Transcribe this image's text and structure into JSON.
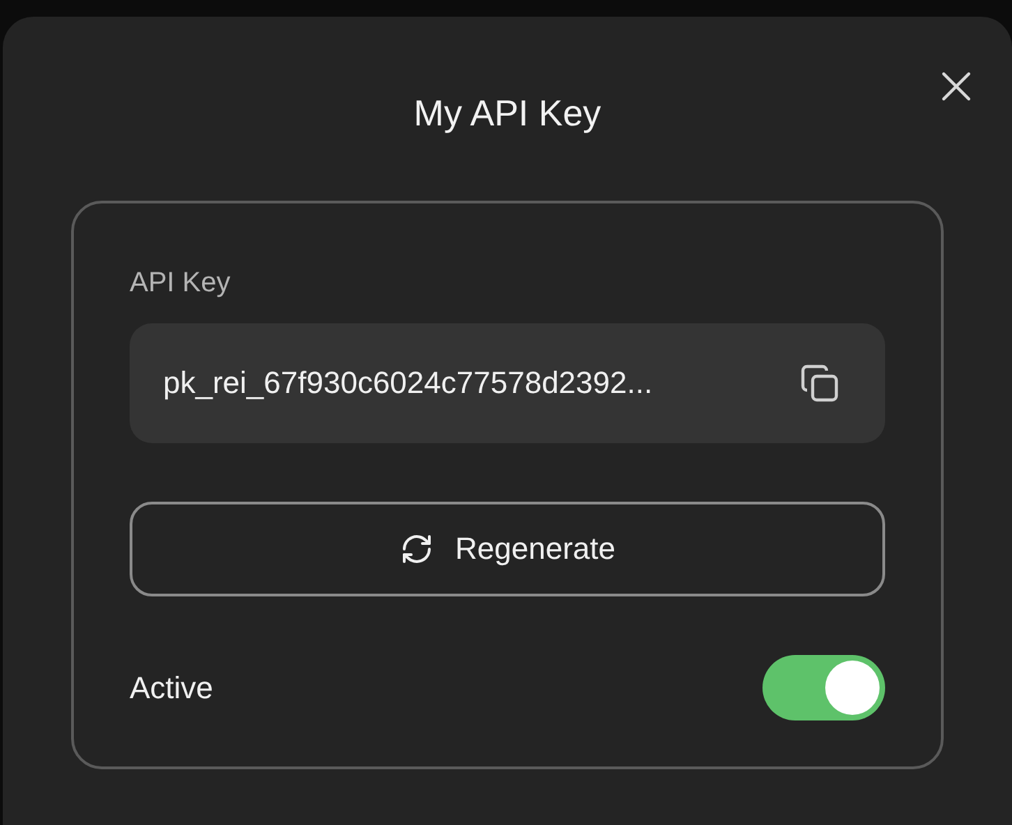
{
  "dialog": {
    "title": "My API Key"
  },
  "card": {
    "key_label": "API Key",
    "key_value": "pk_rei_67f930c6024c77578d2392...",
    "regenerate": "Regenerate",
    "active": {
      "label": "Active",
      "on": true
    }
  }
}
